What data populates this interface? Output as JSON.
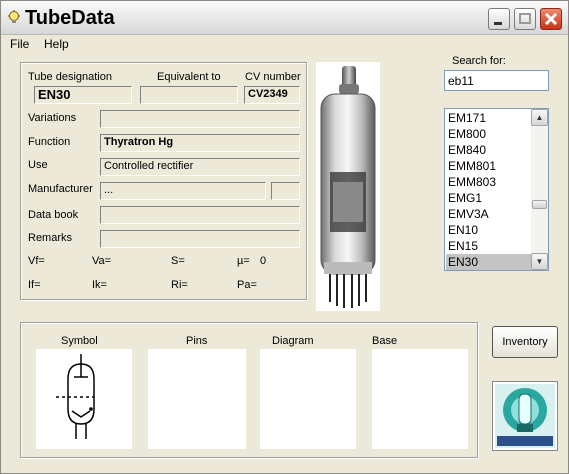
{
  "window": {
    "title": "TubeData"
  },
  "menu": {
    "file": "File",
    "help": "Help"
  },
  "details": {
    "tube_designation_label": "Tube designation",
    "tube_designation": "EN30",
    "equivalent_label": "Equivalent to",
    "equivalent": "",
    "cv_label": "CV number",
    "cv_number": "CV2349",
    "variations_label": "Variations",
    "variations": "",
    "function_label": "Function",
    "function": "Thyratron Hg",
    "use_label": "Use",
    "use": "Controlled rectifier",
    "manufacturer_label": "Manufacturer",
    "manufacturer": "...",
    "databook_label": "Data book",
    "databook": "",
    "remarks_label": "Remarks",
    "remarks": "",
    "params": {
      "vf": "Vf=",
      "va": "Va=",
      "s": "S=",
      "mu": "µ=",
      "mu_value": "0",
      "if": "If=",
      "ik": "Ik=",
      "ri": "Ri=",
      "pa": "Pa="
    }
  },
  "search": {
    "label": "Search for:",
    "value": "eb11"
  },
  "tube_list": {
    "items": [
      "EM171",
      "EM800",
      "EM840",
      "EMM801",
      "EMM803",
      "EMG1",
      "EMV3A",
      "EN10",
      "EN15",
      "EN30"
    ],
    "selected": "EN30"
  },
  "bottom": {
    "symbol_label": "Symbol",
    "pins_label": "Pins",
    "diagram_label": "Diagram",
    "base_label": "Base"
  },
  "inventory_label": "Inventory",
  "colors": {
    "close_button": "#c8331a",
    "selection": "#c4c4c4"
  }
}
